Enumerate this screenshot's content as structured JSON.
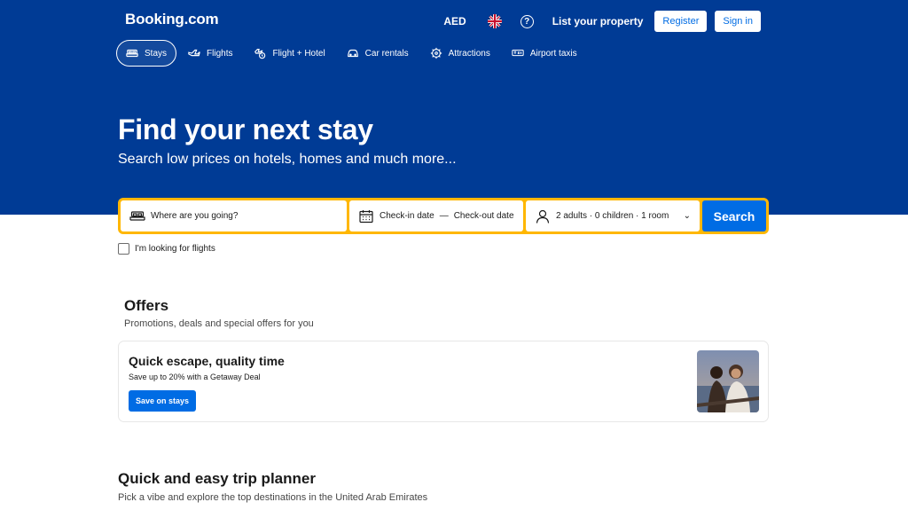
{
  "header": {
    "logo": "Booking.com",
    "currency": "AED",
    "list_property": "List your property",
    "register": "Register",
    "sign_in": "Sign in"
  },
  "nav": {
    "tabs": [
      {
        "label": "Stays",
        "icon": "bed-icon",
        "active": true
      },
      {
        "label": "Flights",
        "icon": "plane-icon"
      },
      {
        "label": "Flight + Hotel",
        "icon": "plane-hotel-icon"
      },
      {
        "label": "Car rentals",
        "icon": "car-icon"
      },
      {
        "label": "Attractions",
        "icon": "attractions-icon"
      },
      {
        "label": "Airport taxis",
        "icon": "taxi-icon"
      }
    ]
  },
  "hero": {
    "title": "Find your next stay",
    "subtitle": "Search low prices on hotels, homes and much more..."
  },
  "search": {
    "destination_placeholder": "Where are you going?",
    "checkin": "Check-in date",
    "dash": "—",
    "checkout": "Check-out date",
    "guests": "2 adults · 0 children · 1 room",
    "search_button": "Search",
    "flights_checkbox": "I'm looking for flights"
  },
  "offers": {
    "title": "Offers",
    "subtitle": "Promotions, deals and special offers for you",
    "card": {
      "title": "Quick escape, quality time",
      "description": "Save up to 20% with a Getaway Deal",
      "button": "Save on stays"
    }
  },
  "planner": {
    "title": "Quick and easy trip planner",
    "subtitle": "Pick a vibe and explore the top destinations in the United Arab Emirates"
  },
  "colors": {
    "brand_blue": "#003b95",
    "accent_blue": "#006ce4",
    "search_border": "#ffb700"
  }
}
